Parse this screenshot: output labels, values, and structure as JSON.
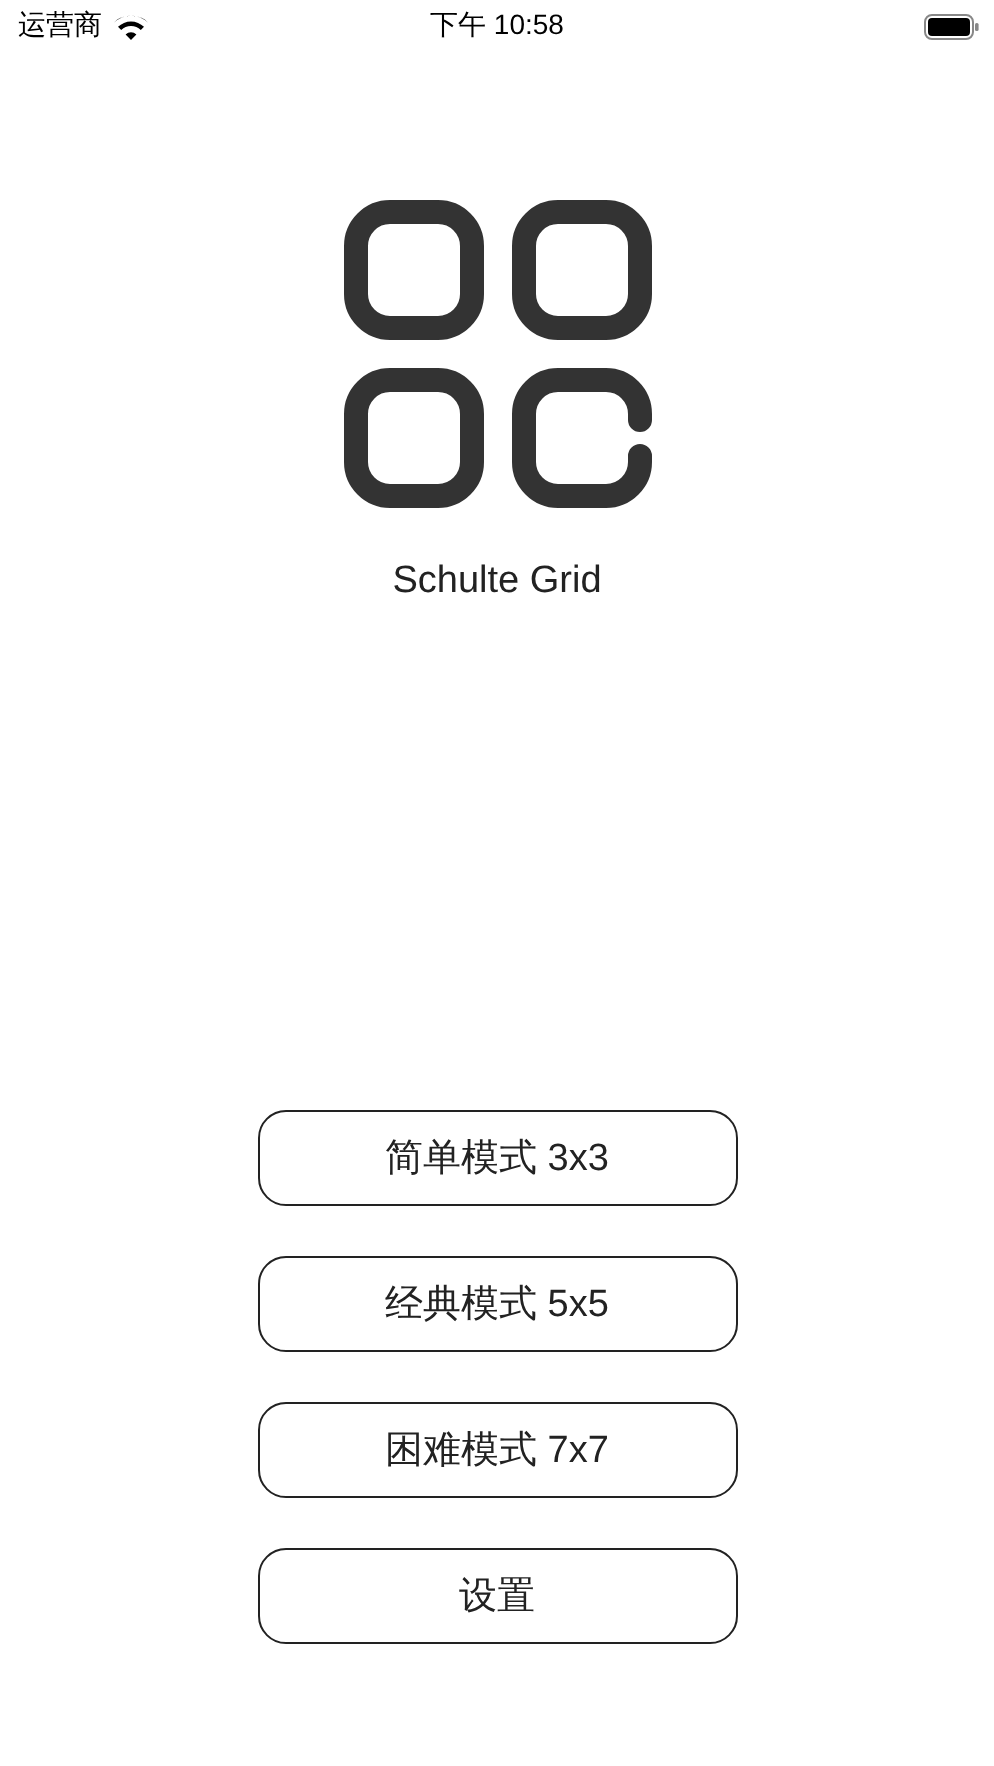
{
  "status_bar": {
    "carrier": "运营商",
    "time": "下午 10:58"
  },
  "app": {
    "title": "Schulte Grid"
  },
  "buttons": [
    {
      "label": "简单模式 3x3"
    },
    {
      "label": "经典模式 5x5"
    },
    {
      "label": "困难模式 7x7"
    },
    {
      "label": "设置"
    }
  ]
}
